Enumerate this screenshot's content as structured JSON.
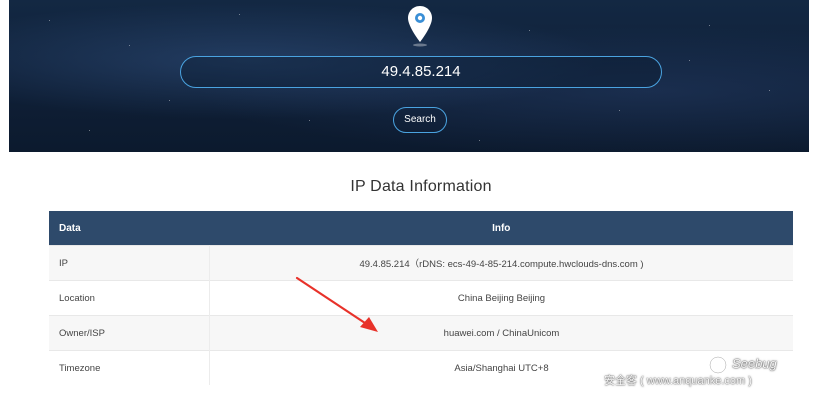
{
  "search": {
    "value": "49.4.85.214",
    "button_label": "Search"
  },
  "section": {
    "title": "IP Data Information"
  },
  "table": {
    "headers": {
      "data": "Data",
      "info": "Info"
    },
    "rows": [
      {
        "label": "IP",
        "value": "49.4.85.214（rDNS: ecs-49-4-85-214.compute.hwclouds-dns.com )"
      },
      {
        "label": "Location",
        "value": "China Beijing Beijing"
      },
      {
        "label": "Owner/ISP",
        "value": "huawei.com / ChinaUnicom"
      },
      {
        "label": "Timezone",
        "value": "Asia/Shanghai UTC+8"
      }
    ]
  },
  "watermark": {
    "brand": "Seebug",
    "site": "安全客 ( www.anquanke.com )"
  },
  "icons": {
    "pin": "map-pin-icon",
    "arrow": "red-arrow-annotation",
    "watermark_logo": "seebug-logo-icon"
  },
  "colors": {
    "hero_bg": "#0f2038",
    "accent": "#4aa3e0",
    "table_header": "#2e4a6b",
    "arrow": "#e8322a"
  }
}
